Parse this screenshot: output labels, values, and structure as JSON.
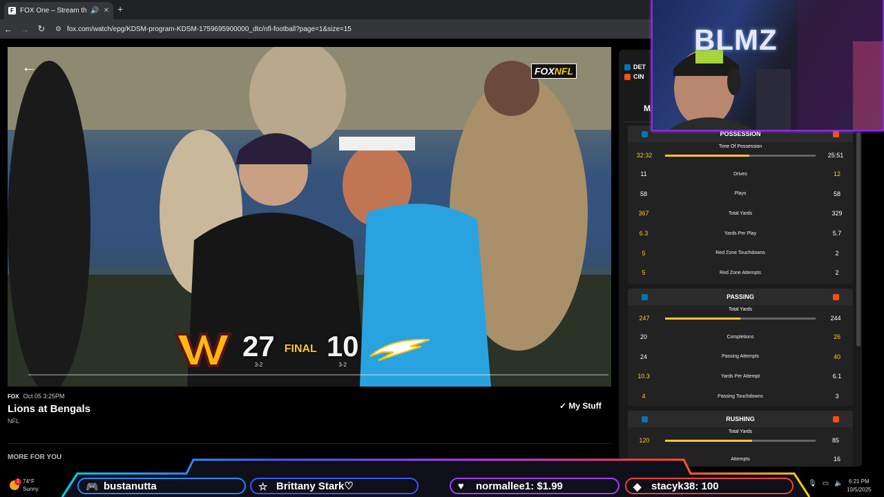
{
  "browser": {
    "tab_title": "FOX One – Stream the Best",
    "favicon_label": "F",
    "url": "fox.com/watch/epg/KDSM-program-KDSM-1759695900000_dtc/nfl-football?page=1&size=15",
    "icons": [
      "back-icon",
      "forward-icon",
      "reload-icon",
      "tune-icon",
      "speaker-icon",
      "close-icon",
      "new-tab-icon"
    ]
  },
  "video": {
    "network_bug": "FOX",
    "network_bug_accent": "NFL",
    "away_score": "27",
    "away_record": "3-2",
    "status": "FINAL",
    "home_score": "10",
    "home_record": "3-2"
  },
  "program": {
    "network": "FOX",
    "airtime": "Oct 05 3:25PM",
    "title": "Lions at Bengals",
    "league": "NFL",
    "my_stuff": "My Stuff",
    "more_for_you": "MORE FOR YOU"
  },
  "stats": {
    "team_a": "DET",
    "team_b": "CIN",
    "active_tab": "MA",
    "accent": "#ffc72c",
    "possession": {
      "title": "POSSESSION",
      "top": {
        "label": "Time Of Possession",
        "a": "32:32",
        "b": "25:51",
        "fill": 0.56
      },
      "rows": [
        {
          "label": "Drives",
          "a": "11",
          "b": "12",
          "hi": "b"
        },
        {
          "label": "Plays",
          "a": "58",
          "b": "58",
          "hi": ""
        },
        {
          "label": "Total Yards",
          "a": "367",
          "b": "329",
          "hi": "a"
        },
        {
          "label": "Yards Per Play",
          "a": "6.3",
          "b": "5.7",
          "hi": "a"
        },
        {
          "label": "Red Zone Touchdowns",
          "a": "5",
          "b": "2",
          "hi": "a"
        },
        {
          "label": "Red Zone Attempts",
          "a": "5",
          "b": "2",
          "hi": "a"
        }
      ]
    },
    "passing": {
      "title": "PASSING",
      "top": {
        "label": "Total Yards",
        "a": "247",
        "b": "244",
        "fill": 0.5
      },
      "rows": [
        {
          "label": "Completions",
          "a": "20",
          "b": "26",
          "hi": "b"
        },
        {
          "label": "Passing Attempts",
          "a": "24",
          "b": "40",
          "hi": "b"
        },
        {
          "label": "Yards Per Attempt",
          "a": "10.3",
          "b": "6.1",
          "hi": "a"
        },
        {
          "label": "Passing Touchdowns",
          "a": "4",
          "b": "3",
          "hi": "a"
        }
      ]
    },
    "rushing": {
      "title": "RUSHING",
      "top": {
        "label": "Total Yards",
        "a": "120",
        "b": "85",
        "fill": 0.58
      },
      "rows": [
        {
          "label": "Attempts",
          "a": "",
          "b": "16",
          "hi": ""
        }
      ]
    }
  },
  "stream": {
    "brand": "BLMZ",
    "tickers": [
      {
        "text": "bustanutta",
        "icon": "discord-icon"
      },
      {
        "text": "Brittany Stark♡",
        "icon": "star-icon"
      },
      {
        "text": "normallee1: $1.99",
        "icon": "donation-icon"
      },
      {
        "text": "stacyk38: 100",
        "icon": "bits-icon"
      }
    ]
  },
  "taskbar": {
    "weather_temp": "74°F",
    "weather_desc": "Sunny",
    "weather_badge": "1",
    "time": "6:21 PM",
    "date": "10/5/2025"
  }
}
